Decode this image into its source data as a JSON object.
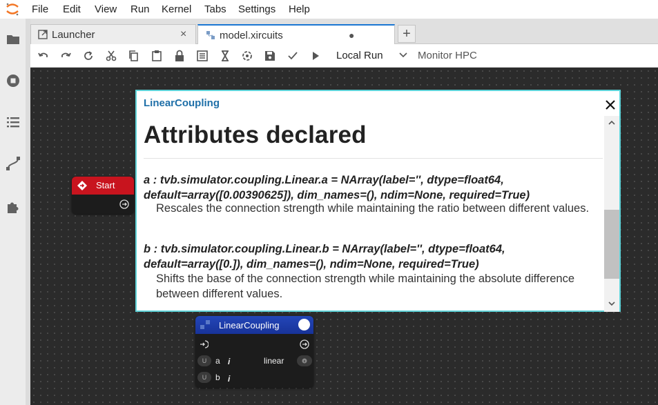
{
  "menu": [
    "File",
    "Edit",
    "View",
    "Run",
    "Kernel",
    "Tabs",
    "Settings",
    "Help"
  ],
  "tabs": [
    {
      "label": "Launcher",
      "close": "×"
    },
    {
      "label": "model.xircuits",
      "close": "●"
    }
  ],
  "add_tab": "+",
  "toolbar": {
    "run_option": "Local Run",
    "monitor_option": "Monitor HPC"
  },
  "start_node": {
    "title": "Start"
  },
  "coupling_node": {
    "title": "LinearCoupling",
    "ports": [
      {
        "badge": "U",
        "name": "a",
        "type_icon": "i",
        "value": "linear"
      },
      {
        "badge": "U",
        "name": "b",
        "type_icon": "i",
        "value": ""
      }
    ]
  },
  "popup": {
    "title": "LinearCoupling",
    "heading": "Attributes declared",
    "close": "×",
    "attributes": [
      {
        "signature": "a : tvb.simulator.coupling.Linear.a = NArray(label='', dtype=float64, default=array([0.00390625]), dim_names=(), ndim=None, required=True)",
        "description": "Rescales the connection strength while maintaining the ratio between different values."
      },
      {
        "signature": "b : tvb.simulator.coupling.Linear.b = NArray(label='', dtype=float64, default=array([0.]), dim_names=(), ndim=None, required=True)",
        "description": "Shifts the base of the connection strength while maintaining the absolute difference between different values."
      }
    ]
  },
  "colors": {
    "accent": "#1976d2",
    "popup_border": "#5fd3d9",
    "start_header": "#c8141e",
    "coupling_header": "#1b3fa8",
    "canvas": "#2b2b2b"
  },
  "icons": {
    "leftbar": [
      "folder-icon",
      "stop-circle-icon",
      "list-icon",
      "xircuits-icon",
      "puzzle-icon"
    ],
    "toolbar": [
      "undo-icon",
      "redo-icon",
      "reload-icon",
      "cut-icon",
      "copy-icon",
      "paste-icon",
      "lock-icon",
      "log-icon",
      "hourglass-icon",
      "compile-icon",
      "save-icon",
      "check-icon",
      "run-icon",
      "chevron-down-icon"
    ]
  }
}
